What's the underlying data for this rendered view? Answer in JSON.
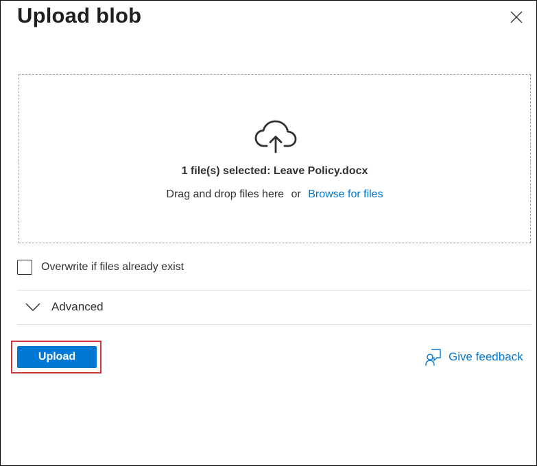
{
  "dialog": {
    "title": "Upload blob",
    "close_icon": "close-icon"
  },
  "dropzone": {
    "icon": "cloud-upload-icon",
    "selected_text": "1 file(s) selected: Leave Policy.docx",
    "drag_text": "Drag and drop files here",
    "or_text": "or",
    "browse_label": "Browse for files"
  },
  "options": {
    "overwrite_label": "Overwrite if files already exist",
    "overwrite_checked": false,
    "advanced_label": "Advanced",
    "advanced_icon": "chevron-down-icon"
  },
  "footer": {
    "upload_label": "Upload",
    "feedback_label": "Give feedback",
    "feedback_icon": "feedback-icon"
  },
  "colors": {
    "accent": "#0078d4",
    "highlight": "#d13438"
  }
}
